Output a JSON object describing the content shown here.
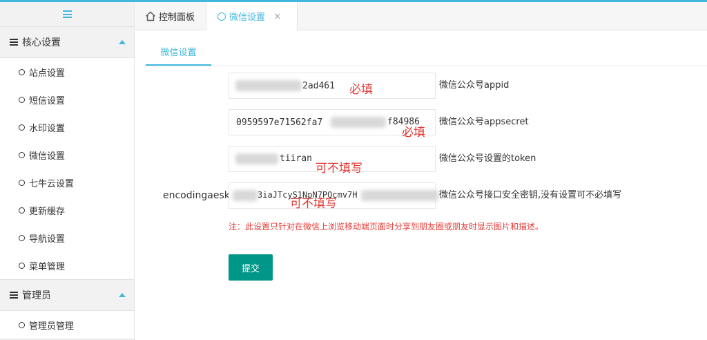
{
  "colors": {
    "accent": "#3fb8e0",
    "submit": "#009688",
    "warning": "#e53935"
  },
  "sidebar": {
    "groups": [
      {
        "label": "核心设置",
        "items": [
          "站点设置",
          "短信设置",
          "水印设置",
          "微信设置",
          "七牛云设置",
          "更新缓存",
          "导航设置",
          "菜单管理"
        ]
      },
      {
        "label": "管理员",
        "items": [
          "管理员管理"
        ]
      }
    ]
  },
  "tabs": {
    "home_label": "控制面板",
    "active_label": "微信设置",
    "close_glyph": "×"
  },
  "subtab": {
    "label": "微信设置"
  },
  "form": {
    "fields": [
      {
        "label": "appid",
        "value": "2ad461",
        "hint": "微信公众号appid",
        "annotation": "必填"
      },
      {
        "label": "appsecret",
        "value": "0959597e71562fa7",
        "value_tail": "f84986",
        "hint": "微信公众号appsecret",
        "annotation": "必填"
      },
      {
        "label": "token",
        "value": "",
        "value_tail": "tiiran",
        "hint": "微信公众号设置的token",
        "annotation": "可不填写"
      },
      {
        "label": "encodingaeskey",
        "value": "",
        "value_tail": "3iaJTcyS1NpN7PQcmv7H",
        "hint": "微信公众号接口安全密钥,没有设置可不必填写",
        "annotation": "可不填写"
      }
    ],
    "notice": "注：此设置只针对在微信上浏览移动端页面时分享到朋友圈或朋友时显示图片和描述。",
    "submit_label": "提交"
  }
}
